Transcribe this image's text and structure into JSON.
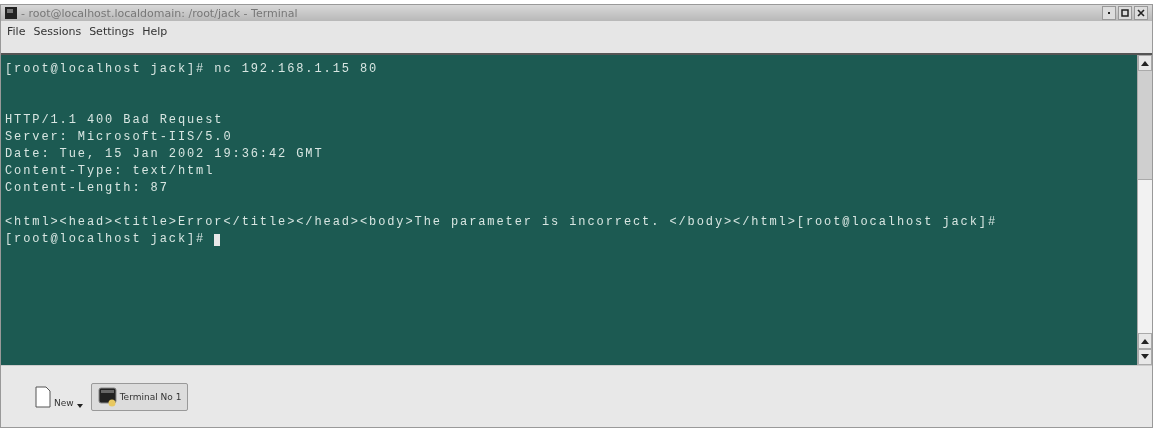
{
  "window": {
    "title": "- root@localhost.localdomain: /root/jack - Terminal"
  },
  "menu": [
    "File",
    "Sessions",
    "Settings",
    "Help"
  ],
  "terminal": {
    "cursor_visible": true,
    "lines": [
      {
        "kind": "text",
        "text": "[root@localhost jack]# nc 192.168.1.15 80"
      },
      {
        "kind": "blank"
      },
      {
        "kind": "blank"
      },
      {
        "kind": "text",
        "text": "HTTP/1.1 400 Bad Request"
      },
      {
        "kind": "text",
        "text": "Server: Microsoft-IIS/5.0"
      },
      {
        "kind": "text",
        "text": "Date: Tue, 15 Jan 2002 19:36:42 GMT"
      },
      {
        "kind": "text",
        "text": "Content-Type: text/html"
      },
      {
        "kind": "text",
        "text": "Content-Length: 87"
      },
      {
        "kind": "blank"
      },
      {
        "kind": "text",
        "text": "<html><head><title>Error</title></head><body>The parameter is incorrect. </body></html>[root@localhost jack]#"
      },
      {
        "kind": "text",
        "text": "[root@localhost jack]# "
      }
    ]
  },
  "taskbar": {
    "new_label": "New",
    "sessions": [
      {
        "label": "Terminal No 1",
        "selected": true
      }
    ]
  }
}
